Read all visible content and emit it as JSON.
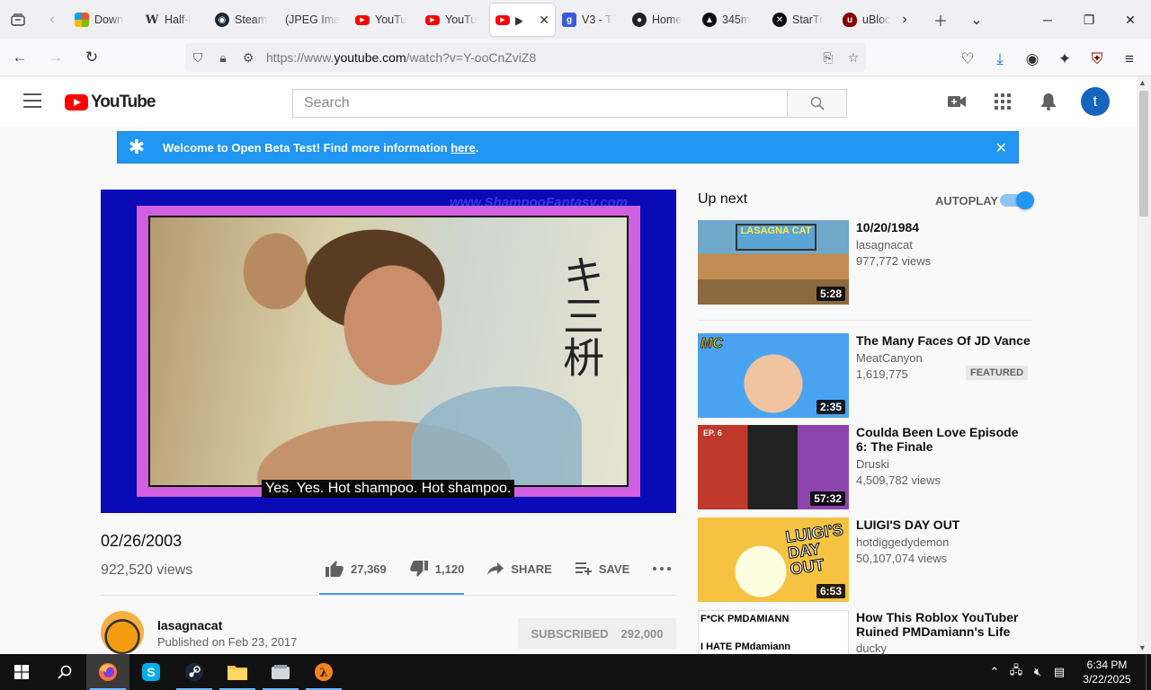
{
  "browser": {
    "tabs": [
      {
        "label": "Down",
        "icon": "microsoft-icon"
      },
      {
        "label": "Half-l",
        "icon": "wikipedia-icon"
      },
      {
        "label": "Steam",
        "icon": "steam-icon"
      },
      {
        "label": "(JPEG Ima",
        "icon": "image-icon"
      },
      {
        "label": "YouTu",
        "icon": "youtube-icon"
      },
      {
        "label": "YouTu",
        "icon": "youtube-icon"
      },
      {
        "label": "▶",
        "icon": "youtube-icon",
        "active": true
      },
      {
        "label": "V3 - T",
        "icon": "g-icon"
      },
      {
        "label": "Home",
        "icon": "home-icon"
      },
      {
        "label": "345m",
        "icon": "dark-icon"
      },
      {
        "label": "StarTr",
        "icon": "dark-icon"
      },
      {
        "label": "uBloc",
        "icon": "ublock-icon"
      }
    ],
    "url_prefix": "https://www.",
    "url_domain": "youtube.com",
    "url_path": "/watch?v=Y-ooCnZviZ8"
  },
  "youtube": {
    "logo_text": "YouTube",
    "search_placeholder": "Search",
    "avatar_letter": "t",
    "banner": {
      "text": "Welcome to Open Beta Test! Find more information ",
      "link": "here",
      "suffix": "."
    },
    "player": {
      "watermark": "www.ShampooFantasy.com",
      "caption": "Yes. Yes. Hot shampoo. Hot shampoo.",
      "kanji": "キ三枡"
    },
    "video": {
      "title": "02/26/2003",
      "views": "922,520 views",
      "likes": "27,369",
      "dislikes": "1,120",
      "share_label": "SHARE",
      "save_label": "SAVE",
      "like_ratio": 0.961
    },
    "channel": {
      "name": "lasagnacat",
      "published": "Published on Feb 23, 2017",
      "subscribe_label": "SUBSCRIBED",
      "subscriber_count": "292,000"
    },
    "sidebar": {
      "upnext_label": "Up next",
      "autoplay_label": "AUTOPLAY",
      "autoplay_on": true,
      "items": [
        {
          "title": "10/20/1984",
          "channel": "lasagnacat",
          "views": "977,772 views",
          "duration": "5:28",
          "thumb_text": "LASAGNA CAT"
        },
        {
          "title": "The Many Faces Of JD Vance",
          "channel": "MeatCanyon",
          "views": "1,619,775",
          "duration": "2:35",
          "badge": "FEATURED",
          "thumb_text": "MC"
        },
        {
          "title": "Coulda Been Love Episode 6: The Finale",
          "channel": "Druski",
          "views": "4,509,782 views",
          "duration": "57:32",
          "thumb_text": "EP. 6"
        },
        {
          "title": "LUIGI'S DAY OUT",
          "channel": "hotdiggedydemon",
          "views": "50,107,074 views",
          "duration": "6:53",
          "thumb_text": "LUIGI'S DAY OUT"
        },
        {
          "title": "How This Roblox YouTuber Ruined PMDamiann's Life",
          "channel": "ducky",
          "views": "",
          "duration": "",
          "thumb_text_1": "F*CK PMDAMIANN",
          "thumb_text_2": "I HATE PMdamiann"
        }
      ]
    }
  },
  "taskbar": {
    "time": "6:34 PM",
    "date": "3/22/2025"
  },
  "colors": {
    "banner": "#2196f3",
    "yt_red": "#ff0000",
    "link_blue": "#4d96e8"
  }
}
